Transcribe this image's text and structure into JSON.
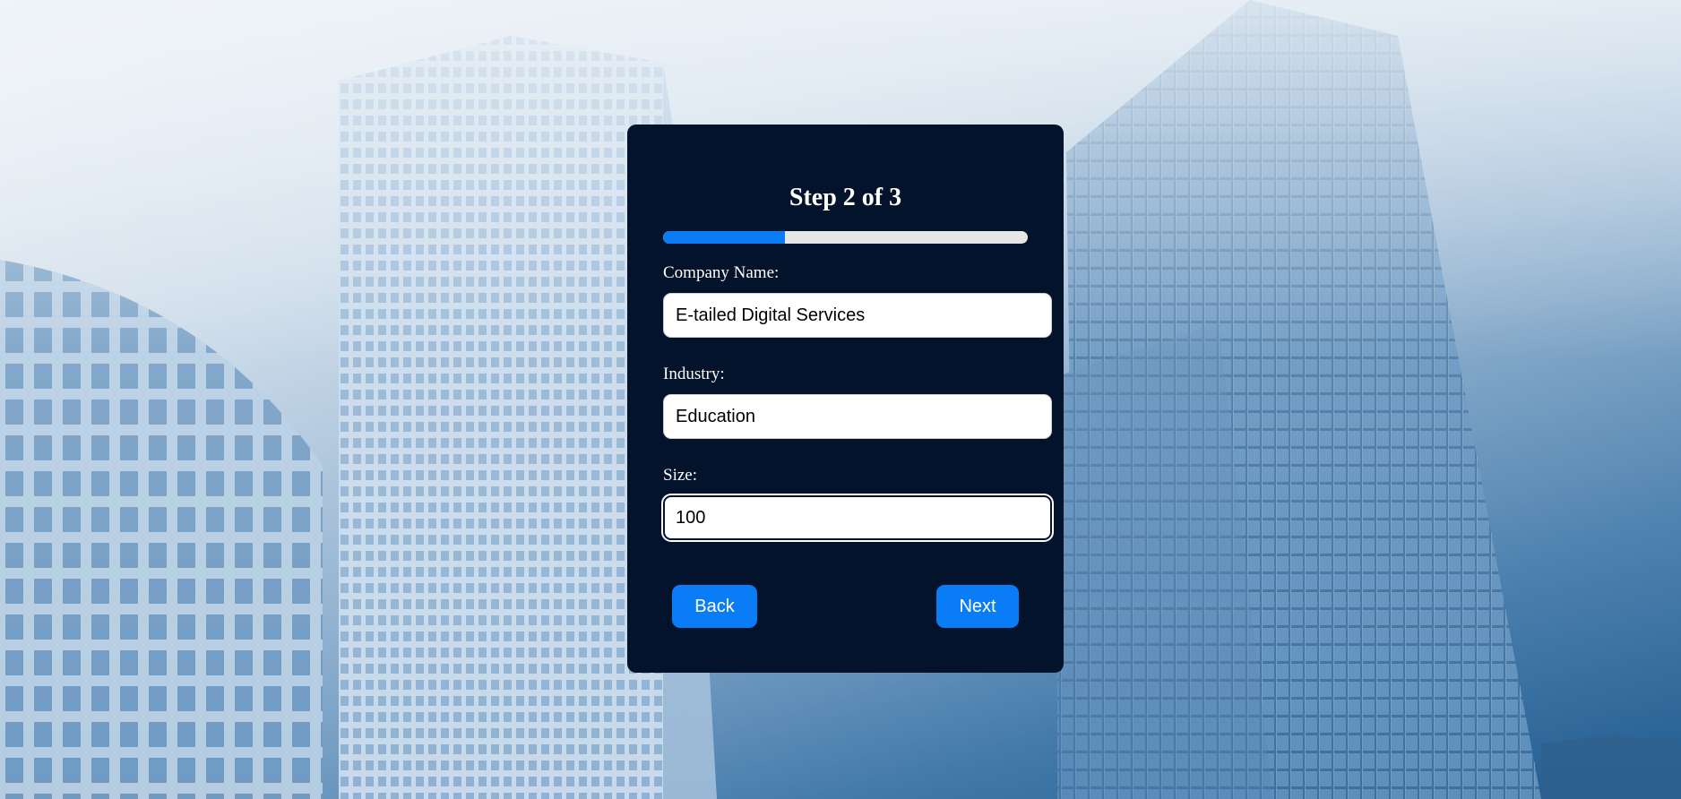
{
  "wizard": {
    "title": "Step 2 of 3",
    "progress_fraction": 0.333,
    "fields": {
      "company_name": {
        "label": "Company Name:",
        "value": "E-tailed Digital Services"
      },
      "industry": {
        "label": "Industry:",
        "value": "Education"
      },
      "size": {
        "label": "Size:",
        "value": "100"
      }
    },
    "buttons": {
      "back_label": "Back",
      "next_label": "Next"
    }
  },
  "colors": {
    "card_background": "#03132b",
    "accent": "#0a7cf5",
    "progress_track": "#e6e6e6"
  }
}
